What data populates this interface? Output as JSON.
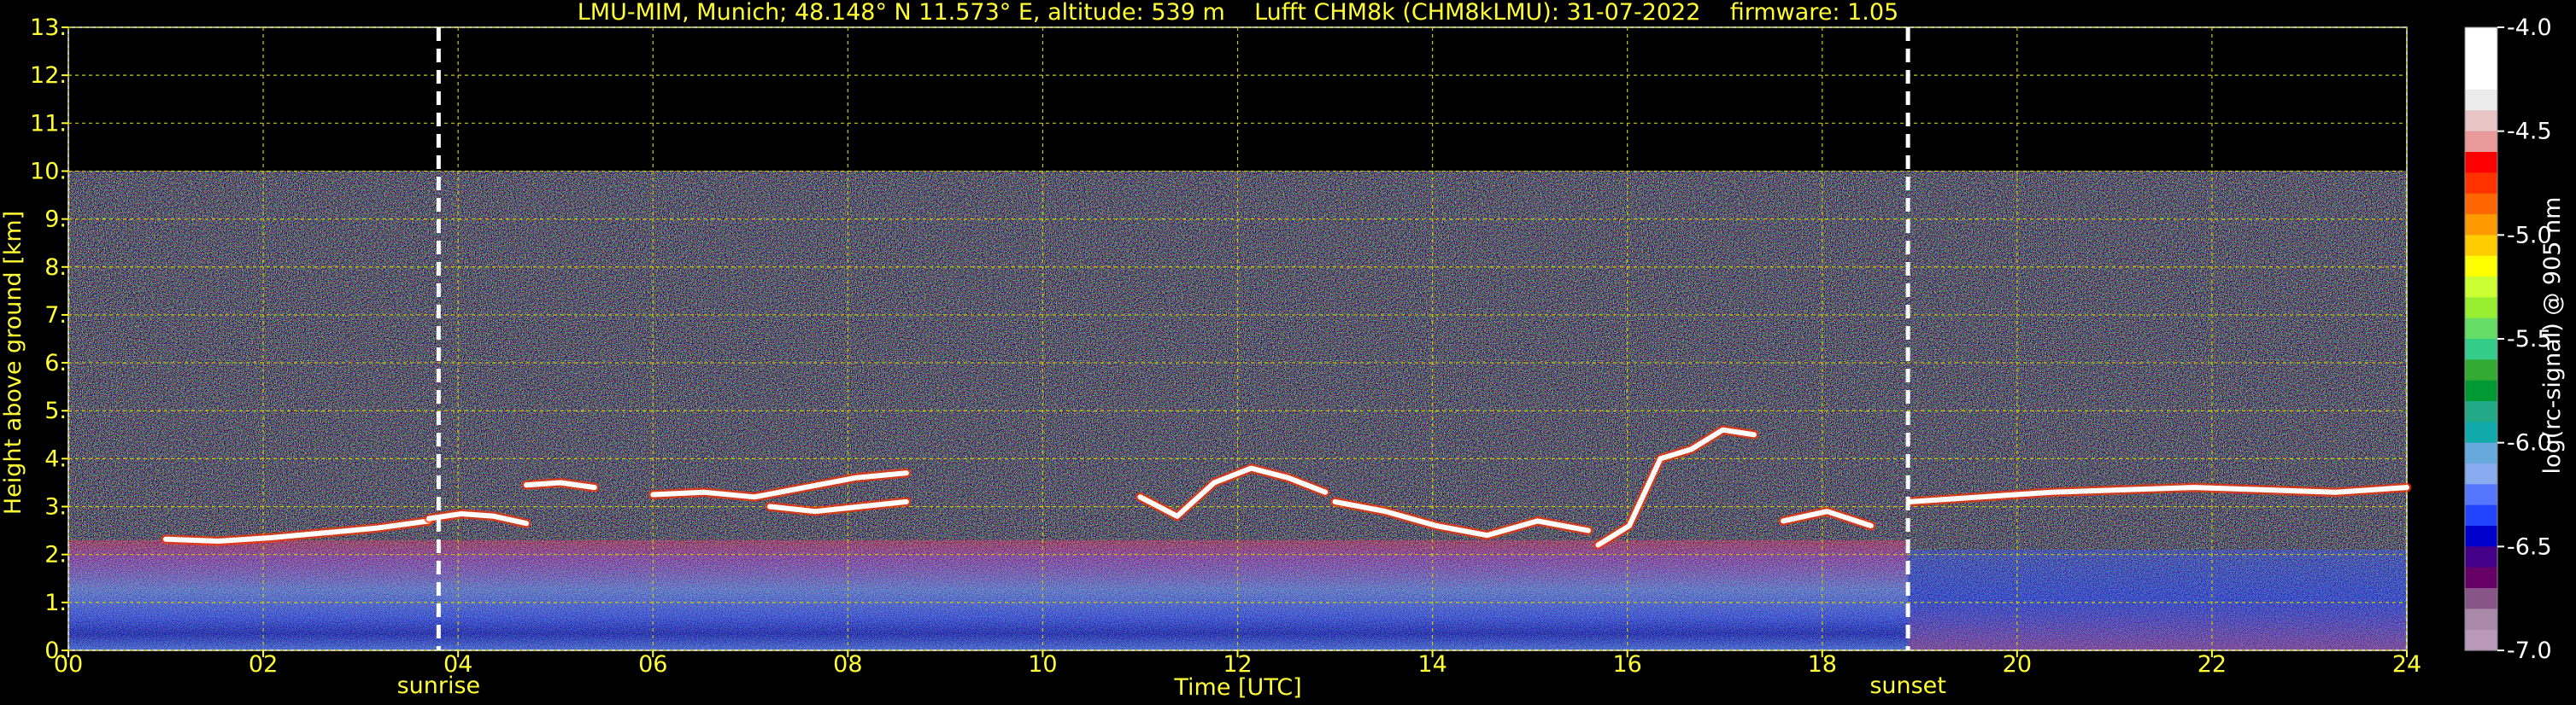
{
  "chart_data": {
    "type": "heatmap",
    "title": "LMU-MIM, Munich; 48.148° N 11.573° E, altitude: 539 m    Lufft CHM8k (CHM8kLMU): 31-07-2022    firmware: 1.05",
    "xlabel": "Time [UTC]",
    "ylabel": "Height above ground [km]",
    "xlim": [
      0,
      24
    ],
    "ylim": [
      0,
      13
    ],
    "x_ticks": [
      "00",
      "02",
      "04",
      "06",
      "08",
      "10",
      "12",
      "14",
      "16",
      "18",
      "20",
      "22",
      "24"
    ],
    "x_tick_values": [
      0,
      2,
      4,
      6,
      8,
      10,
      12,
      14,
      16,
      18,
      20,
      22,
      24
    ],
    "y_ticks": [
      "0.",
      "1.",
      "2.",
      "3.",
      "4.",
      "5.",
      "6.",
      "7.",
      "8.",
      "9.",
      "10.",
      "11.",
      "12.",
      "13."
    ],
    "y_tick_values": [
      0,
      1,
      2,
      3,
      4,
      5,
      6,
      7,
      8,
      9,
      10,
      11,
      12,
      13
    ],
    "grid": true,
    "data_top_km": 10,
    "annotations": [
      {
        "label": "sunrise",
        "x": 3.8
      },
      {
        "label": "sunset",
        "x": 18.88
      }
    ],
    "colorbar": {
      "label": "log(rc-signal) @ 905 nm",
      "range": [
        -7.0,
        -4.0
      ],
      "ticks": [
        "-4.0",
        "-4.5",
        "-5.0",
        "-5.5",
        "-6.0",
        "-6.5",
        "-7.0"
      ],
      "tick_values": [
        -4.0,
        -4.5,
        -5.0,
        -5.5,
        -6.0,
        -6.5,
        -7.0
      ],
      "colors_top_to_bottom": [
        "#ffffff",
        "#ffffff",
        "#ffffff",
        "#ececec",
        "#e8c4c4",
        "#e89a9a",
        "#ff0000",
        "#ff3300",
        "#ff6600",
        "#ff9900",
        "#ffcc00",
        "#ffff00",
        "#ccff33",
        "#99ee33",
        "#66dd66",
        "#33cc88",
        "#33aa33",
        "#009933",
        "#22aa88",
        "#11aaaa",
        "#66aadd",
        "#88aaee",
        "#5577ff",
        "#2244ff",
        "#0000cc",
        "#440088",
        "#660066",
        "#885588",
        "#aa88aa",
        "#bb99bb"
      ]
    },
    "cloud_layers": [
      {
        "x_start": 1.0,
        "x_end": 3.7,
        "height_km": [
          2.32,
          2.28,
          2.35,
          2.45,
          2.55,
          2.7
        ]
      },
      {
        "x_start": 3.7,
        "x_end": 4.7,
        "height_km": [
          2.75,
          2.85,
          2.8,
          2.65
        ]
      },
      {
        "x_start": 4.7,
        "x_end": 5.4,
        "height_km": [
          3.45,
          3.5,
          3.4
        ]
      },
      {
        "x_start": 6.0,
        "x_end": 8.6,
        "height_km": [
          3.25,
          3.3,
          3.2,
          3.4,
          3.6,
          3.7
        ]
      },
      {
        "x_start": 7.2,
        "x_end": 8.6,
        "height_km": [
          3.0,
          2.9,
          3.0,
          3.1
        ]
      },
      {
        "x_start": 11.0,
        "x_end": 12.9,
        "height_km": [
          3.2,
          2.8,
          3.5,
          3.8,
          3.6,
          3.3
        ]
      },
      {
        "x_start": 13.0,
        "x_end": 15.6,
        "height_km": [
          3.1,
          2.9,
          2.6,
          2.4,
          2.7,
          2.5
        ]
      },
      {
        "x_start": 15.7,
        "x_end": 17.3,
        "height_km": [
          2.2,
          2.6,
          4.0,
          4.2,
          4.6,
          4.5
        ]
      },
      {
        "x_start": 17.6,
        "x_end": 18.5,
        "height_km": [
          2.7,
          2.9,
          2.6
        ]
      },
      {
        "x_start": 18.9,
        "x_end": 24.0,
        "height_km": [
          3.1,
          3.2,
          3.3,
          3.35,
          3.4,
          3.35,
          3.3,
          3.4
        ]
      }
    ]
  }
}
